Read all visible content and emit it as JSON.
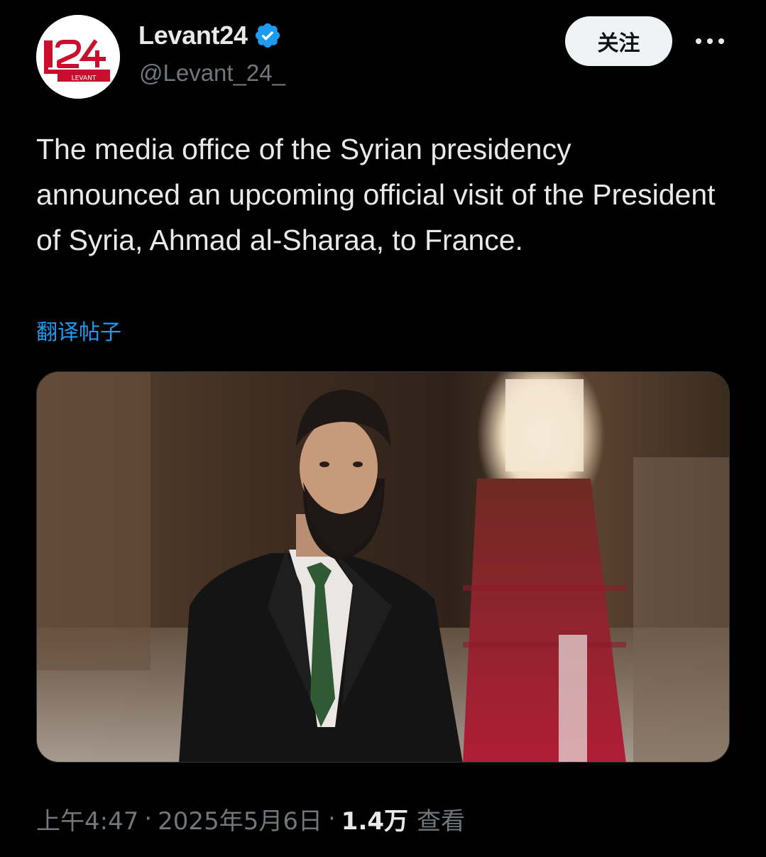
{
  "account": {
    "display_name": "Levant24",
    "handle": "@Levant_24_",
    "verified": true,
    "avatar_text": "L24",
    "avatar_subtext": "LEVANT"
  },
  "actions": {
    "follow_label": "关注",
    "more_icon": "more-horizontal-icon"
  },
  "post": {
    "text": "The media office of the Syrian presidency announced an upcoming official visit of the President of Syria, Ahmad al-Sharaa, to France.",
    "translate_label": "翻译帖子",
    "media": {
      "icon": "photo-image"
    }
  },
  "meta": {
    "time": "上午4:47",
    "separator": "·",
    "date": "2025年5月6日",
    "views_count": "1.4万",
    "views_label": "查看"
  },
  "colors": {
    "background": "#000000",
    "text_primary": "#e7e9ea",
    "text_secondary": "#71767b",
    "link": "#1d9bf0",
    "verified": "#1d9bf0",
    "follow_bg": "#eff3f4",
    "brand_red": "#c8102e"
  }
}
